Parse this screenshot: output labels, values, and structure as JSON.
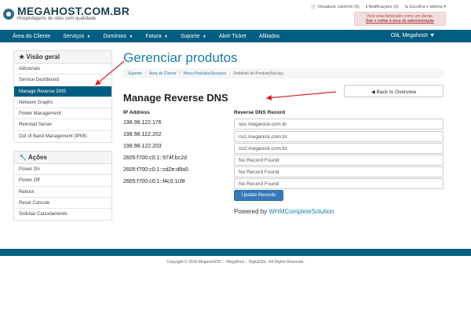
{
  "header": {
    "logo_title": "MEGAHOST.COM.BR",
    "logo_subtitle": "Hospedagens de sites com qualidade",
    "top_links": [
      {
        "label": "Visualizar carrinho (0)",
        "icon": "cart-icon"
      },
      {
        "label": "Notificações (3)",
        "icon": "info-icon"
      },
      {
        "label": "Escolha o idioma",
        "icon": "language-icon"
      }
    ],
    "alert_line1": "Você está disfarçado como um cliente.",
    "alert_line2": "Sair e voltar à área de administração"
  },
  "nav": {
    "items": [
      {
        "label": "Área do Cliente",
        "dropdown": false
      },
      {
        "label": "Serviços",
        "dropdown": true
      },
      {
        "label": "Domínios",
        "dropdown": true
      },
      {
        "label": "Fatura",
        "dropdown": true
      },
      {
        "label": "Suporte",
        "dropdown": true
      },
      {
        "label": "Abrir Ticket",
        "dropdown": false
      },
      {
        "label": "Afiliados",
        "dropdown": false
      }
    ],
    "user_label": "Olá, Megahost!"
  },
  "sidebar": {
    "overview_title": "Visão geral",
    "overview_items": [
      {
        "label": "Adicionais",
        "active": false
      },
      {
        "label": "Service Dashboard",
        "active": false
      },
      {
        "label": "Manage Reverse DNS",
        "active": true
      },
      {
        "label": "Network Graphs",
        "active": false
      },
      {
        "label": "Power Management",
        "active": false
      },
      {
        "label": "Reinstall Server",
        "active": false
      },
      {
        "label": "Out of Band Management (IPMI)",
        "active": false
      }
    ],
    "actions_title": "Ações",
    "actions_items": [
      {
        "label": "Power On"
      },
      {
        "label": "Power Off"
      },
      {
        "label": "Reboot"
      },
      {
        "label": "Reset Console"
      },
      {
        "label": "Solicitar Cancelamento"
      }
    ]
  },
  "main": {
    "page_title": "Gerenciar produtos",
    "breadcrumb": [
      "Suporte",
      "Área do Cliente",
      "Meus Produtos/Serviços",
      "Detalhes do Produto/Serviço"
    ],
    "section_title": "Manage Reverse DNS",
    "back_button": "Back to Overview",
    "col_ip": "IP Address",
    "col_dns": "Reverse DNS Record",
    "records": [
      {
        "ip": "198.98.122.176",
        "dns": "vps.meganick.com.br"
      },
      {
        "ip": "198.98.122.202",
        "dns": "ns1.meganick.com.br"
      },
      {
        "ip": "198.98.122.203",
        "dns": "ns2.meganick.com.br"
      },
      {
        "ip": "2605:f700:c0:1::974f:bc2d",
        "dns": "No Record Found"
      },
      {
        "ip": "2605:f700:c0:1::cd2e:d8a5",
        "dns": "No Record Found"
      },
      {
        "ip": "2605:f700:c0:1::f4c0:1cf8",
        "dns": "No Record Found"
      }
    ],
    "update_button": "Update Records",
    "powered_prefix": "Powered by",
    "powered_link": "WHMCompleteSolution"
  },
  "footer": {
    "copyright": "Copyright © 2016 MeganickIDC :: MegaHost :: DigitalSSL. All Rights Reserved."
  },
  "colors": {
    "brand": "#005e82",
    "title": "#1a7ca8",
    "annotation": "#e02020"
  }
}
